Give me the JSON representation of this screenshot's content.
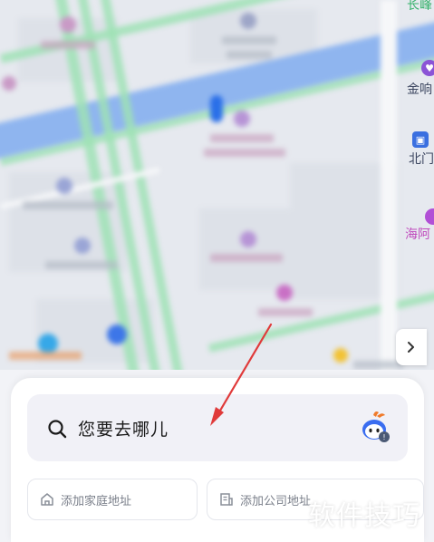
{
  "map": {
    "labels": {
      "top_right": "长峰",
      "poi_1": "金响",
      "poi_2": "北门",
      "poi_3": "海阿"
    }
  },
  "search": {
    "placeholder": "您要去哪儿"
  },
  "quick_actions": [
    {
      "label": "添加家庭地址",
      "icon": "home-icon"
    },
    {
      "label": "添加公司地址",
      "icon": "building-icon"
    }
  ],
  "watermark": "软件技巧",
  "colors": {
    "accent_arrow": "#e03a3a",
    "mascot_orange": "#f07a2a",
    "mascot_blue": "#3a6df0"
  }
}
